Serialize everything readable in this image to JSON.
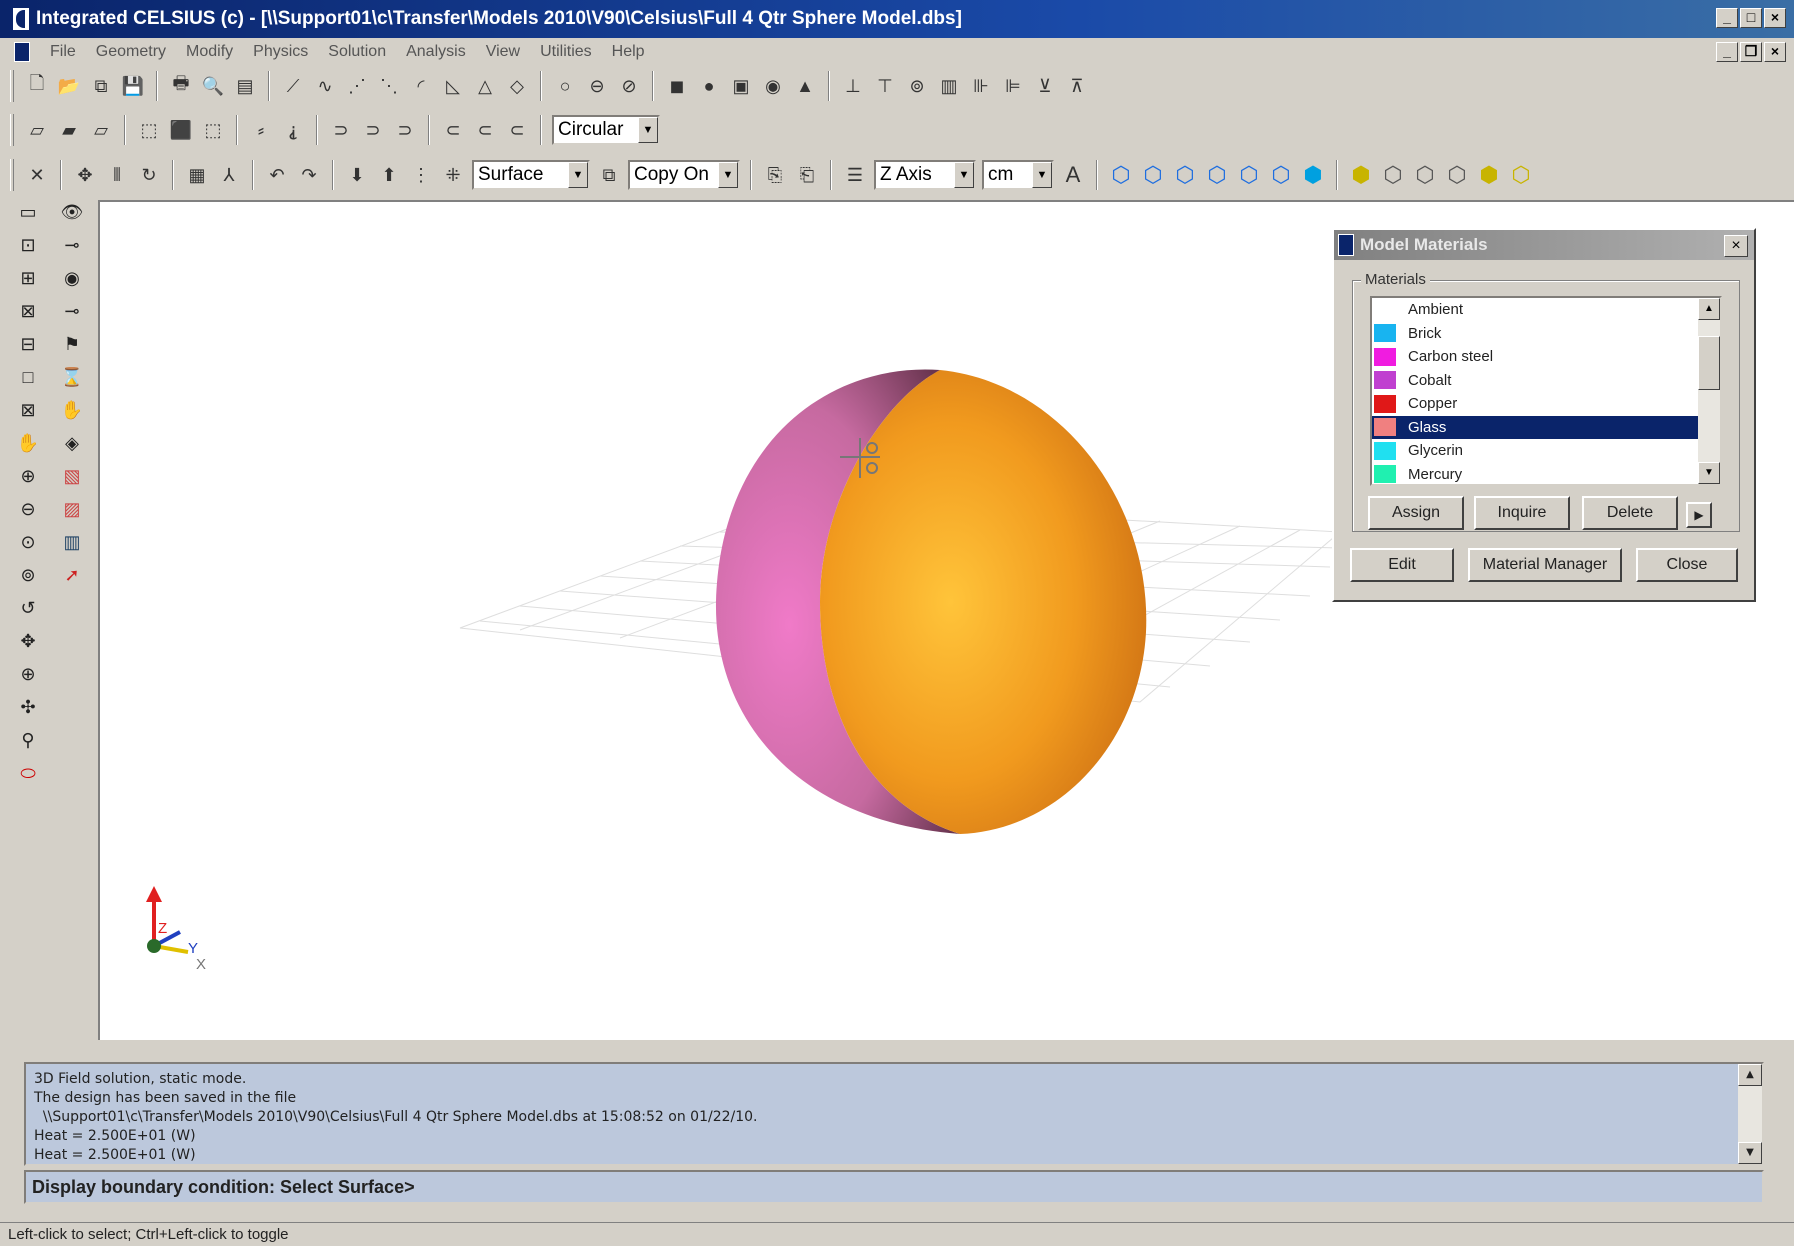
{
  "window": {
    "title": "Integrated CELSIUS (c) - [\\\\Support01\\c\\Transfer\\Models 2010\\V90\\Celsius\\Full 4 Qtr Sphere Model.dbs]"
  },
  "menu": [
    "File",
    "Geometry",
    "Modify",
    "Physics",
    "Solution",
    "Analysis",
    "View",
    "Utilities",
    "Help"
  ],
  "toolbar": {
    "arc_mode": "Circular",
    "selection_type": "Surface",
    "copy_mode": "Copy On",
    "axis": "Z Axis",
    "units": "cm"
  },
  "dialog": {
    "title": "Model Materials",
    "group_label": "Materials",
    "materials": [
      {
        "name": "Ambient",
        "color": "#ffffff"
      },
      {
        "name": "Brick",
        "color": "#18b4f0"
      },
      {
        "name": "Carbon steel",
        "color": "#f01ce0"
      },
      {
        "name": "Cobalt",
        "color": "#c040d0"
      },
      {
        "name": "Copper",
        "color": "#e01818"
      },
      {
        "name": "Glass",
        "color": "#f08080"
      },
      {
        "name": "Glycerin",
        "color": "#20e0f0"
      },
      {
        "name": "Mercury",
        "color": "#20f0b0"
      }
    ],
    "selected": "Glass",
    "buttons": {
      "assign": "Assign",
      "inquire": "Inquire",
      "delete": "Delete",
      "edit": "Edit",
      "material_manager": "Material Manager",
      "close": "Close"
    }
  },
  "axes": {
    "z": "Z",
    "y": "Y",
    "x": "X"
  },
  "output": {
    "lines": [
      "3D Field solution, static mode.",
      "The design has been saved in the file",
      "  \\\\Support01\\c\\Transfer\\Models 2010\\V90\\Celsius\\Full 4 Qtr Sphere Model.dbs at 15:08:52 on 01/22/10.",
      "Heat = 2.500E+01 (W)",
      "Heat = 2.500E+01 (W)"
    ]
  },
  "prompt": "Display boundary condition: Select Surface>",
  "status": "Left-click to select; Ctrl+Left-click to toggle"
}
